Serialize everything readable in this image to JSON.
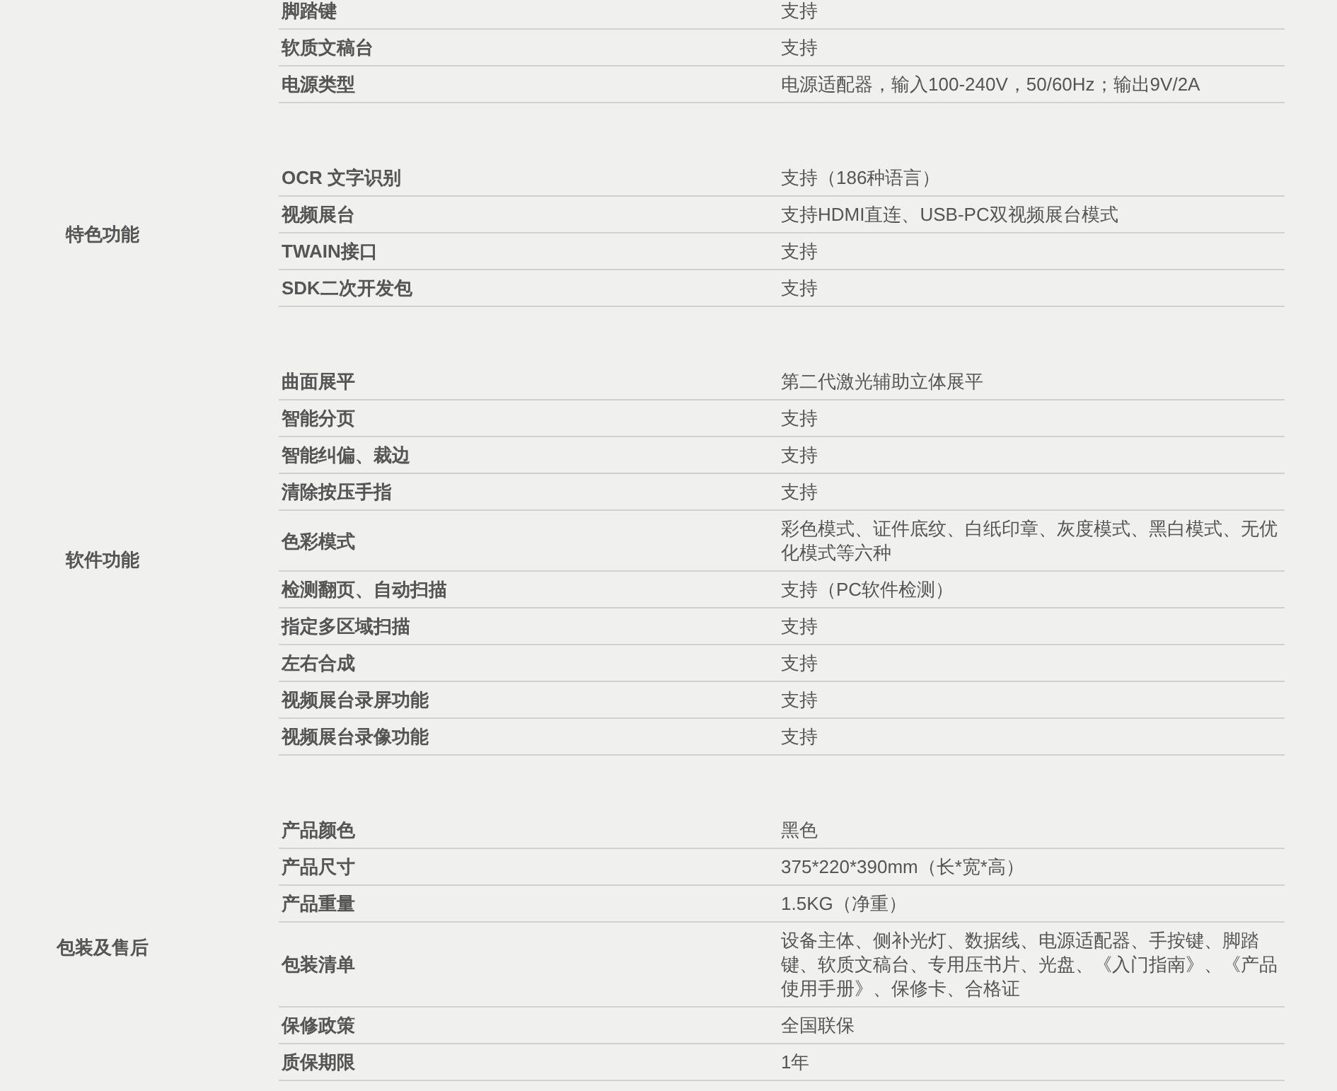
{
  "sections": [
    {
      "rows": [
        {
          "name": "脚踏键",
          "value": "支持"
        },
        {
          "name": "软质文稿台",
          "value": "支持"
        },
        {
          "name": "电源类型",
          "value": "电源适配器，输入100-240V，50/60Hz；输出9V/2A"
        }
      ]
    },
    {
      "category": "特色功能",
      "rows": [
        {
          "name": "OCR 文字识别",
          "value": "支持（186种语言）"
        },
        {
          "name": "视频展台",
          "value": "支持HDMI直连、USB-PC双视频展台模式"
        },
        {
          "name": "TWAIN接口",
          "value": "支持"
        },
        {
          "name": "SDK二次开发包",
          "value": "支持"
        }
      ]
    },
    {
      "category": "软件功能",
      "rows": [
        {
          "name": "曲面展平",
          "value": "第二代激光辅助立体展平"
        },
        {
          "name": "智能分页",
          "value": "支持"
        },
        {
          "name": "智能纠偏、裁边",
          "value": "支持"
        },
        {
          "name": "清除按压手指",
          "value": "支持"
        },
        {
          "name": "色彩模式",
          "value": "彩色模式、证件底纹、白纸印章、灰度模式、黑白模式、无优化模式等六种"
        },
        {
          "name": "检测翻页、自动扫描",
          "value": "支持（PC软件检测）"
        },
        {
          "name": "指定多区域扫描",
          "value": "支持"
        },
        {
          "name": "左右合成",
          "value": "支持"
        },
        {
          "name": "视频展台录屏功能",
          "value": "支持"
        },
        {
          "name": "视频展台录像功能",
          "value": "支持"
        }
      ]
    },
    {
      "category": "包装及售后",
      "rows": [
        {
          "name": "产品颜色",
          "value": "黑色"
        },
        {
          "name": "产品尺寸",
          "value": "375*220*390mm（长*宽*高）"
        },
        {
          "name": "产品重量",
          "value": "1.5KG（净重）"
        },
        {
          "name": "包装清单",
          "value": "设备主体、侧补光灯、数据线、电源适配器、手按键、脚踏键、软质文稿台、专用压书片、光盘、《入门指南》、《产品使用手册》、保修卡、合格证"
        },
        {
          "name": "保修政策",
          "value": "全国联保"
        },
        {
          "name": "质保期限",
          "value": "1年"
        }
      ]
    }
  ]
}
